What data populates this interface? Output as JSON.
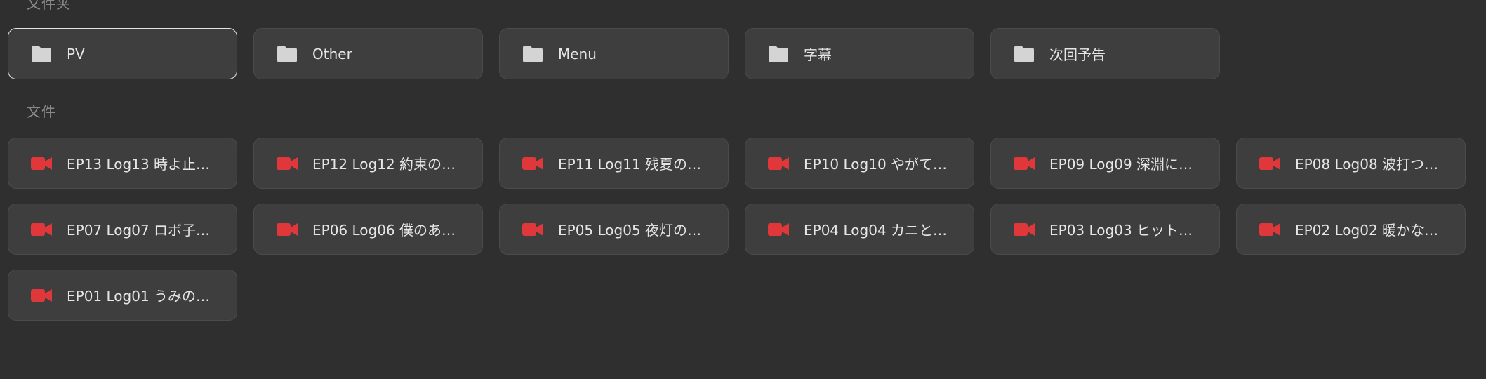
{
  "sections": {
    "folders_title": "文件夹",
    "files_title": "文件"
  },
  "folders": [
    {
      "label": "PV",
      "icon": "folder-icon",
      "selected": true
    },
    {
      "label": "Other",
      "icon": "folder-icon"
    },
    {
      "label": "Menu",
      "icon": "folder-icon"
    },
    {
      "label": "字幕",
      "icon": "folder-icon"
    },
    {
      "label": "次回予告",
      "icon": "folder-icon"
    }
  ],
  "files": [
    {
      "label": "EP13 Log13 時よ止…",
      "icon": "video-camera-icon"
    },
    {
      "label": "EP12 Log12 約束の…",
      "icon": "video-camera-icon"
    },
    {
      "label": "EP11 Log11 残夏の…",
      "icon": "video-camera-icon"
    },
    {
      "label": "EP10 Log10 やがて…",
      "icon": "video-camera-icon"
    },
    {
      "label": "EP09 Log09 深淵に…",
      "icon": "video-camera-icon"
    },
    {
      "label": "EP08 Log08 波打つ…",
      "icon": "video-camera-icon"
    },
    {
      "label": "EP07 Log07 ロボ子…",
      "icon": "video-camera-icon"
    },
    {
      "label": "EP06 Log06 僕のあ…",
      "icon": "video-camera-icon"
    },
    {
      "label": "EP05 Log05 夜灯の…",
      "icon": "video-camera-icon"
    },
    {
      "label": "EP04 Log04 カニと…",
      "icon": "video-camera-icon"
    },
    {
      "label": "EP03 Log03 ヒット…",
      "icon": "video-camera-icon"
    },
    {
      "label": "EP02 Log02 暖かな…",
      "icon": "video-camera-icon"
    },
    {
      "label": "EP01 Log01 うみの…",
      "icon": "video-camera-icon"
    }
  ],
  "colors": {
    "background": "#2f2f2f",
    "card": "#3e3e3e",
    "folder_icon": "#d4d4d4",
    "video_icon": "#e0383a",
    "text": "#e6e6e6",
    "section_title": "#8a8a8a"
  }
}
